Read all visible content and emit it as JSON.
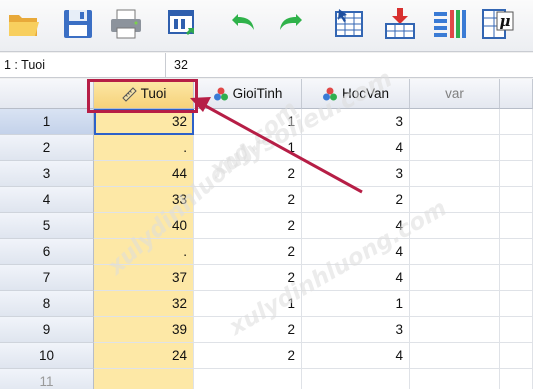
{
  "toolbar": {
    "buttons": [
      {
        "name": "open-folder-icon"
      },
      {
        "name": "save-icon"
      },
      {
        "name": "print-icon"
      },
      {
        "name": "dialog-recall-icon"
      },
      {
        "name": "undo-icon"
      },
      {
        "name": "redo-icon"
      },
      {
        "name": "go-to-case-icon"
      },
      {
        "name": "go-to-variable-icon"
      },
      {
        "name": "variables-icon"
      },
      {
        "name": "statistics-mu-icon"
      }
    ],
    "mu_glyph": "μ"
  },
  "editbar": {
    "cell_ref": "1 : Tuoi",
    "cell_value": "32"
  },
  "columns": [
    {
      "label": "Tuoi",
      "icon": "ruler-icon"
    },
    {
      "label": "GioiTinh",
      "icon": "nominal-icon"
    },
    {
      "label": "HocVan",
      "icon": "nominal-icon"
    },
    {
      "label": "var",
      "icon": ""
    }
  ],
  "rows": [
    {
      "n": "1",
      "tuoi": "32",
      "gioitinh": "1",
      "hocvan": "3"
    },
    {
      "n": "2",
      "tuoi": ".",
      "gioitinh": "1",
      "hocvan": "4"
    },
    {
      "n": "3",
      "tuoi": "44",
      "gioitinh": "2",
      "hocvan": "3"
    },
    {
      "n": "4",
      "tuoi": "33",
      "gioitinh": "2",
      "hocvan": "2"
    },
    {
      "n": "5",
      "tuoi": "40",
      "gioitinh": "2",
      "hocvan": "4"
    },
    {
      "n": "6",
      "tuoi": ".",
      "gioitinh": "2",
      "hocvan": "4"
    },
    {
      "n": "7",
      "tuoi": "37",
      "gioitinh": "2",
      "hocvan": "4"
    },
    {
      "n": "8",
      "tuoi": "32",
      "gioitinh": "1",
      "hocvan": "1"
    },
    {
      "n": "9",
      "tuoi": "39",
      "gioitinh": "2",
      "hocvan": "3"
    },
    {
      "n": "10",
      "tuoi": "24",
      "gioitinh": "2",
      "hocvan": "4"
    },
    {
      "n": "11",
      "tuoi": "",
      "gioitinh": "",
      "hocvan": ""
    }
  ],
  "watermark": {
    "text1": "xulysolieu.com",
    "text2": "xulydinhluong.com",
    "text3": "xulydinhluong.com"
  },
  "colors": {
    "accent": "#b61e46",
    "active_column": "#fde8a6",
    "selection": "#2d61c9"
  }
}
